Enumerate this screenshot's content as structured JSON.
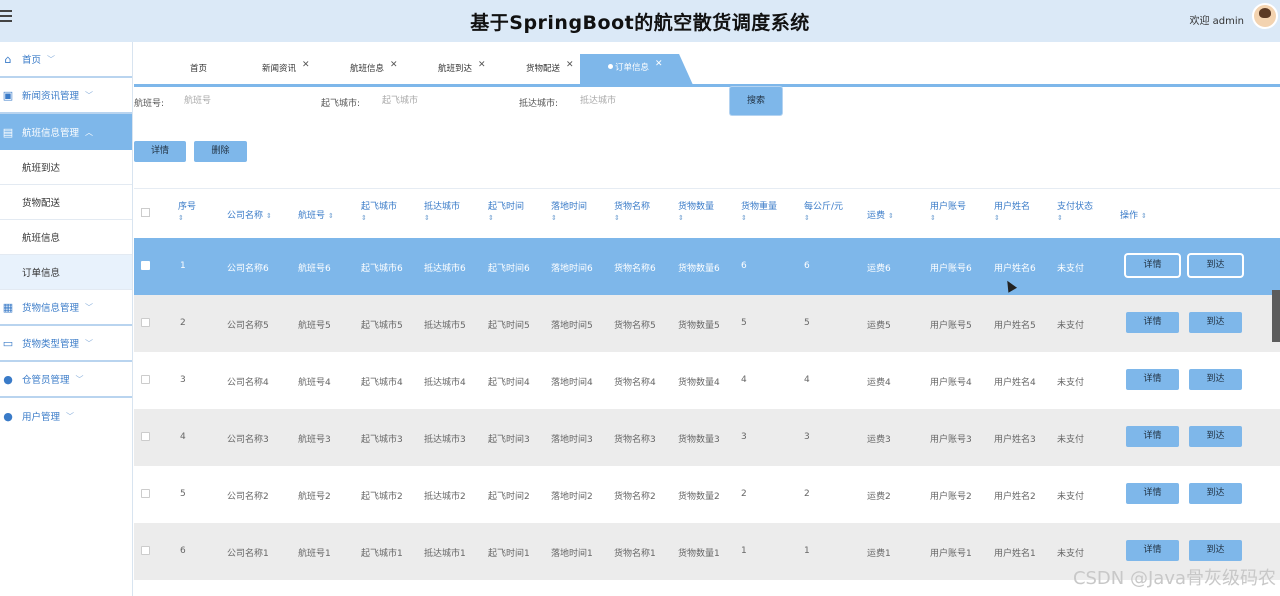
{
  "header": {
    "title": "基于SpringBoot的航空散货调度系统",
    "welcome": "欢迎 admin"
  },
  "sidebar": {
    "items": [
      {
        "label": "首页",
        "icon": "home-icon"
      },
      {
        "label": "新闻资讯管理",
        "icon": "news-icon"
      },
      {
        "label": "航班信息管理",
        "icon": "flight-icon",
        "expanded": true,
        "children": [
          "航班到达",
          "货物配送",
          "航班信息",
          "订单信息"
        ]
      },
      {
        "label": "货物信息管理",
        "icon": "cargo-icon"
      },
      {
        "label": "货物类型管理",
        "icon": "category-icon"
      },
      {
        "label": "仓管员管理",
        "icon": "warehouse-icon"
      },
      {
        "label": "用户管理",
        "icon": "user-icon"
      }
    ]
  },
  "tabs": [
    {
      "label": "首页",
      "closable": false
    },
    {
      "label": "新闻资讯",
      "closable": true
    },
    {
      "label": "航班信息",
      "closable": true
    },
    {
      "label": "航班到达",
      "closable": true
    },
    {
      "label": "货物配送",
      "closable": true
    },
    {
      "label": "订单信息",
      "closable": true,
      "active": true
    }
  ],
  "search": {
    "flight_label": "航班号:",
    "flight_placeholder": "航班号",
    "depart_label": "起飞城市:",
    "depart_placeholder": "起飞城市",
    "arrive_label": "抵达城市:",
    "arrive_placeholder": "抵达城市",
    "search_button": "搜索"
  },
  "toolbar": {
    "detail_label": "详情",
    "delete_label": "删除"
  },
  "table": {
    "columns": [
      "序号",
      "公司名称",
      "航班号",
      "起飞城市",
      "抵达城市",
      "起飞时间",
      "落地时间",
      "货物名称",
      "货物数量",
      "货物重量",
      "每公斤/元",
      "运费",
      "用户账号",
      "用户姓名",
      "支付状态",
      "操作"
    ],
    "rows": [
      [
        "1",
        "公司名称6",
        "航班号6",
        "起飞城市6",
        "抵达城市6",
        "起飞时间6",
        "落地时间6",
        "货物名称6",
        "货物数量6",
        "6",
        "6",
        "运费6",
        "用户账号6",
        "用户姓名6",
        "未支付"
      ],
      [
        "2",
        "公司名称5",
        "航班号5",
        "起飞城市5",
        "抵达城市5",
        "起飞时间5",
        "落地时间5",
        "货物名称5",
        "货物数量5",
        "5",
        "5",
        "运费5",
        "用户账号5",
        "用户姓名5",
        "未支付"
      ],
      [
        "3",
        "公司名称4",
        "航班号4",
        "起飞城市4",
        "抵达城市4",
        "起飞时间4",
        "落地时间4",
        "货物名称4",
        "货物数量4",
        "4",
        "4",
        "运费4",
        "用户账号4",
        "用户姓名4",
        "未支付"
      ],
      [
        "4",
        "公司名称3",
        "航班号3",
        "起飞城市3",
        "抵达城市3",
        "起飞时间3",
        "落地时间3",
        "货物名称3",
        "货物数量3",
        "3",
        "3",
        "运费3",
        "用户账号3",
        "用户姓名3",
        "未支付"
      ],
      [
        "5",
        "公司名称2",
        "航班号2",
        "起飞城市2",
        "抵达城市2",
        "起飞时间2",
        "落地时间2",
        "货物名称2",
        "货物数量2",
        "2",
        "2",
        "运费2",
        "用户账号2",
        "用户姓名2",
        "未支付"
      ],
      [
        "6",
        "公司名称1",
        "航班号1",
        "起飞城市1",
        "抵达城市1",
        "起飞时间1",
        "落地时间1",
        "货物名称1",
        "货物数量1",
        "1",
        "1",
        "运费1",
        "用户账号1",
        "用户姓名1",
        "未支付"
      ]
    ],
    "row_actions": {
      "detail": "详情",
      "arrive": "到达"
    }
  },
  "watermark": "CSDN @Java骨灰级码农",
  "colors": {
    "accent": "#7eb7ea",
    "header_bg": "#dbe9f7",
    "link": "#3a7bc8"
  }
}
